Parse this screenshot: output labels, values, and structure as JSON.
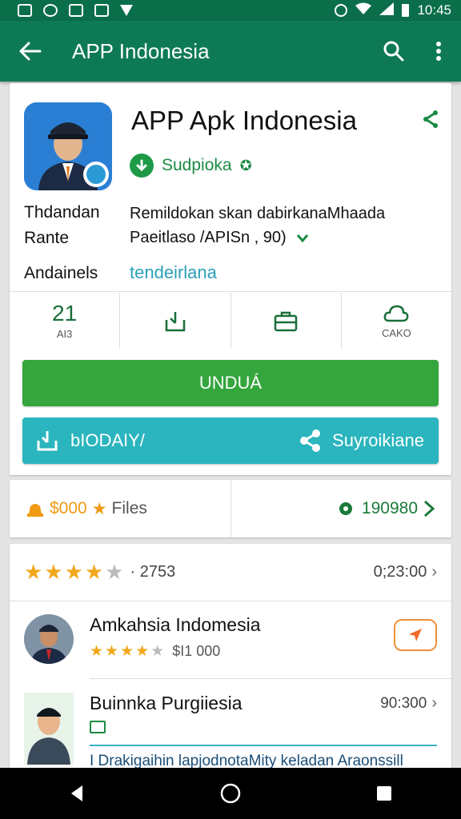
{
  "status_bar": {
    "time": "10:45"
  },
  "app_bar": {
    "title": "APP Indonesia"
  },
  "app": {
    "name": "APP Apk Indonesia",
    "developer": "Sudpioka",
    "meta_label_1": "Thdandan",
    "meta_label_1b": "Rante",
    "meta_value_1": "Remildokan skan dabirkanaMhaada",
    "meta_value_1b": "Paeitlaso /APISn ,    90)",
    "meta_label_2": "Andainels",
    "meta_link": "tendeirlana"
  },
  "stats": [
    {
      "big": "21",
      "small": "AI3"
    },
    {
      "big": "",
      "small": ""
    },
    {
      "big": "",
      "small": ""
    },
    {
      "big": "",
      "small": "CAKO"
    }
  ],
  "buttons": {
    "install": "UNDUÁ",
    "secondary_left": "bIODAIY/",
    "secondary_right": "Suyroikiane"
  },
  "summary": {
    "left_value": "$000",
    "left_label": "Files",
    "right_value": "190980"
  },
  "rating": {
    "count": "2753",
    "time": "0;23:00"
  },
  "items": [
    {
      "title": "Amkahsia Indomesia",
      "price": "$I1 000"
    },
    {
      "title": "Buinnka Purgiiesia",
      "time": "90:300",
      "description": "I Drakigaihin lapjodnotaMity keladan Araonssill"
    }
  ],
  "colors": {
    "header": "#0e7a55",
    "install": "#34a63d",
    "secondary": "#2bb5be",
    "star": "#f2a81c"
  }
}
